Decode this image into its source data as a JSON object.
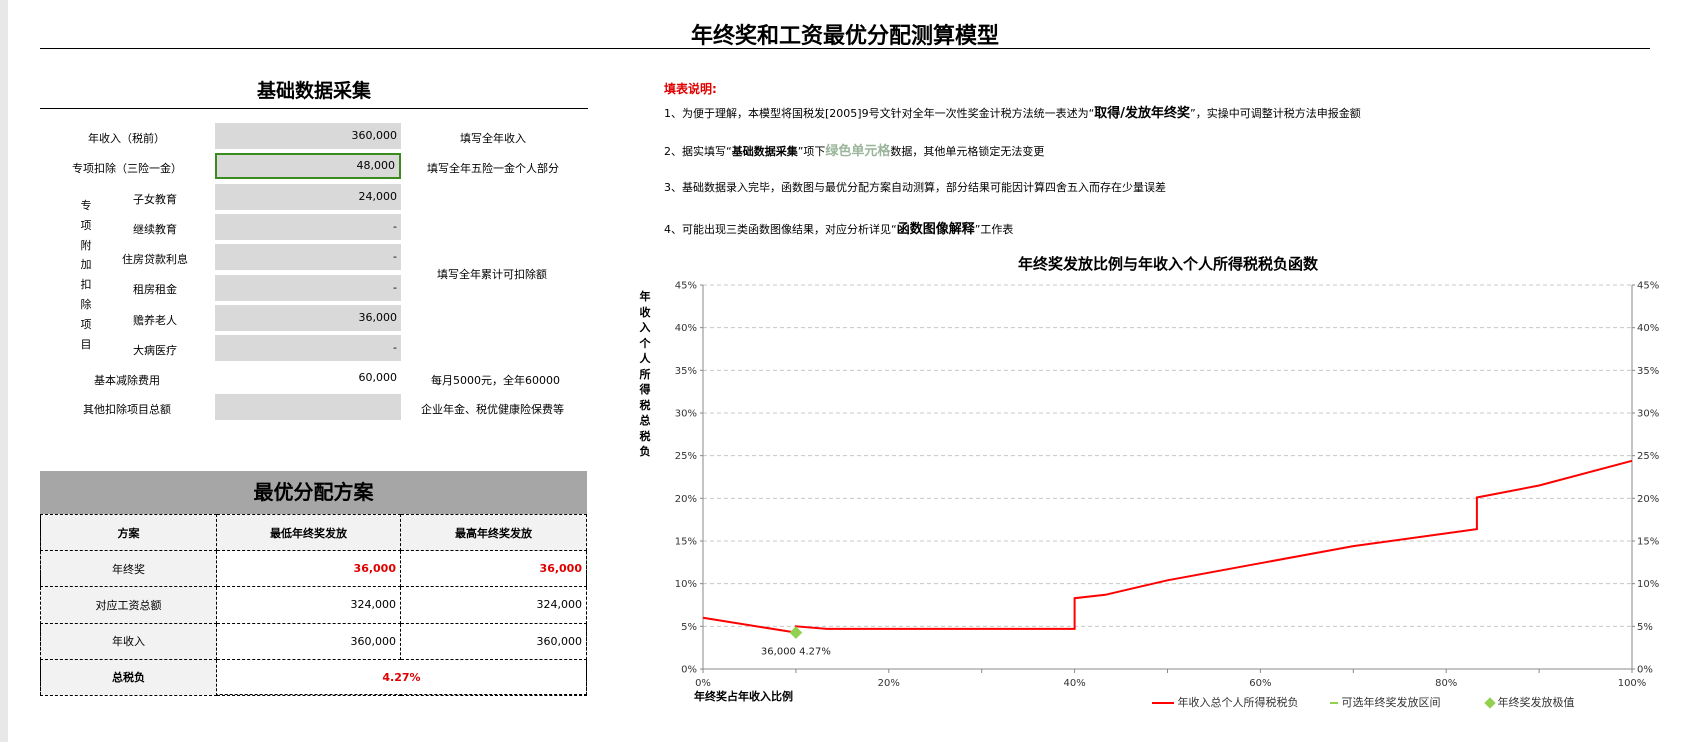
{
  "main_title": "年终奖和工资最优分配测算模型",
  "basic": {
    "title": "基础数据采集",
    "annual_income": {
      "label": "年收入（税前）",
      "value": "360,000",
      "note": "填写全年收入"
    },
    "special_deduction": {
      "label": "专项扣除（三险一金）",
      "value": "48,000",
      "note": "填写全年五险一金个人部分"
    },
    "extra_group_label": [
      "专",
      "项",
      "附",
      "加",
      "扣",
      "除",
      "项",
      "目"
    ],
    "extra_items": [
      {
        "label": "子女教育",
        "value": "24,000"
      },
      {
        "label": "继续教育",
        "value": "-"
      },
      {
        "label": "住房贷款利息",
        "value": "-"
      },
      {
        "label": "租房租金",
        "value": "-"
      },
      {
        "label": "赡养老人",
        "value": "36,000"
      },
      {
        "label": "大病医疗",
        "value": "-"
      }
    ],
    "extra_note": "填写全年累计可扣除额",
    "basic_deduction": {
      "label": "基本减除费用",
      "value": "60,000",
      "note": "每月5000元，全年60000"
    },
    "other_deduction": {
      "label": "其他扣除项目总额",
      "value": "",
      "note": "企业年金、税优健康险保费等"
    }
  },
  "optimal": {
    "title": "最优分配方案",
    "headers": [
      "方案",
      "最低年终奖发放",
      "最高年终奖发放"
    ],
    "rows": [
      {
        "label": "年终奖",
        "low": "36,000",
        "high": "36,000"
      },
      {
        "label": "对应工资总额",
        "low": "324,000",
        "high": "324,000"
      },
      {
        "label": "年收入",
        "low": "360,000",
        "high": "360,000"
      }
    ],
    "total_label": "总税负",
    "total_value": "4.27%"
  },
  "instructions": {
    "title": "填表说明:",
    "line1_pre": "1、为便于理解，本模型将国税发[2005]9号文针对全年一次性奖金计税方法统一表述为“",
    "line1_bold": "取得/发放年终奖",
    "line1_post": "”，实操中可调整计税方法申报金额",
    "line2_pre": "2、据实填写“",
    "line2_bold": "基础数据采集",
    "line2_mid": "”项下",
    "line2_green": "绿色单元格",
    "line2_post": "数据，其他单元格锁定无法变更",
    "line3": "3、基础数据录入完毕，函数图与最优分配方案自动测算，部分结果可能因计算四舍五入而存在少量误差",
    "line4_pre": "4、可能出现三类函数图像结果，对应分析详见“",
    "line4_bold": "函数图像解释",
    "line4_post": "”工作表"
  },
  "chart_data": {
    "type": "line",
    "title": "年终奖发放比例与年收入个人所得税税负函数",
    "xlabel": "年终奖占年收入比例",
    "ylabel": "年收入个人所得税总税负",
    "ylabel_chars": [
      "年",
      "收",
      "入",
      "个",
      "人",
      "所",
      "得",
      "税",
      "总",
      "税",
      "负"
    ],
    "xlim": [
      0,
      1
    ],
    "ylim": [
      0,
      0.45
    ],
    "x_ticks": [
      "0%",
      "20%",
      "40%",
      "60%",
      "80%",
      "100%"
    ],
    "x_tick_values": [
      0,
      0.2,
      0.4,
      0.6,
      0.8,
      1.0
    ],
    "y_ticks": [
      "0%",
      "5%",
      "10%",
      "15%",
      "20%",
      "25%",
      "30%",
      "35%",
      "40%",
      "45%"
    ],
    "y_tick_values": [
      0,
      0.05,
      0.1,
      0.15,
      0.2,
      0.25,
      0.3,
      0.35,
      0.4,
      0.45
    ],
    "grid": true,
    "series": [
      {
        "name": "年收入总个人所得税税负",
        "color": "#ff0000",
        "x": [
          0,
          0.1,
          0.1,
          0.133,
          0.4,
          0.4,
          0.433,
          0.5,
          0.6,
          0.7,
          0.833,
          0.833,
          0.9,
          1.0
        ],
        "y": [
          0.06,
          0.0427,
          0.05,
          0.047,
          0.047,
          0.083,
          0.087,
          0.104,
          0.124,
          0.144,
          0.164,
          0.201,
          0.215,
          0.244
        ]
      }
    ],
    "range_series": {
      "name": "可选年终奖发放区间",
      "color": "#92d050"
    },
    "optimum": {
      "name": "年终奖发放极值",
      "color": "#92d050",
      "x": 0.1,
      "y": 0.0427,
      "label": "36,000 4.27%"
    }
  }
}
